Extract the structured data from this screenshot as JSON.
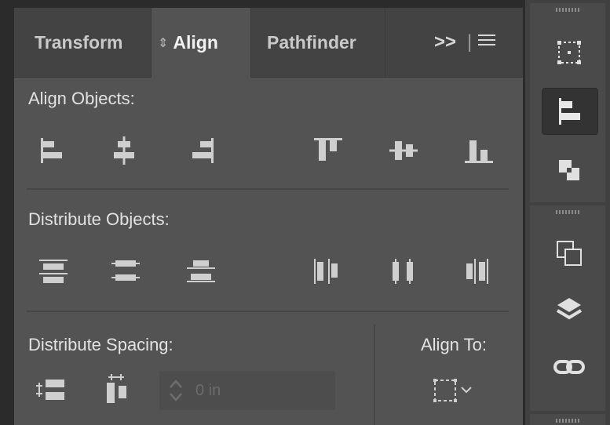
{
  "tabs": [
    {
      "label": "Transform"
    },
    {
      "label": "Align"
    },
    {
      "label": "Pathfinder"
    }
  ],
  "tab_overflow": ">>",
  "sections": {
    "align_objects": "Align Objects:",
    "distribute_objects": "Distribute Objects:",
    "distribute_spacing": "Distribute Spacing:",
    "align_to": "Align To:"
  },
  "spacing_field": {
    "value": "0 in"
  },
  "icons": {
    "align_objects": [
      "align-left-icon",
      "align-horizontal-center-icon",
      "align-right-icon",
      "align-top-icon",
      "align-vertical-center-icon",
      "align-bottom-icon"
    ],
    "distribute_objects": [
      "distribute-top-icon",
      "distribute-vertical-center-icon",
      "distribute-bottom-icon",
      "distribute-left-icon",
      "distribute-horizontal-center-icon",
      "distribute-right-icon"
    ],
    "distribute_spacing": [
      "vertical-distribute-space-icon",
      "horizontal-distribute-space-icon"
    ],
    "align_to": "align-to-selection-icon"
  },
  "rail": [
    "transform-icon",
    "align-icon",
    "pathfinder-icon",
    "layers-icon",
    "links-icon"
  ],
  "colors": {
    "panel": "#535353",
    "tabbar": "#434343",
    "text": "#e2e2e2",
    "icon": "#cfcfcf"
  }
}
